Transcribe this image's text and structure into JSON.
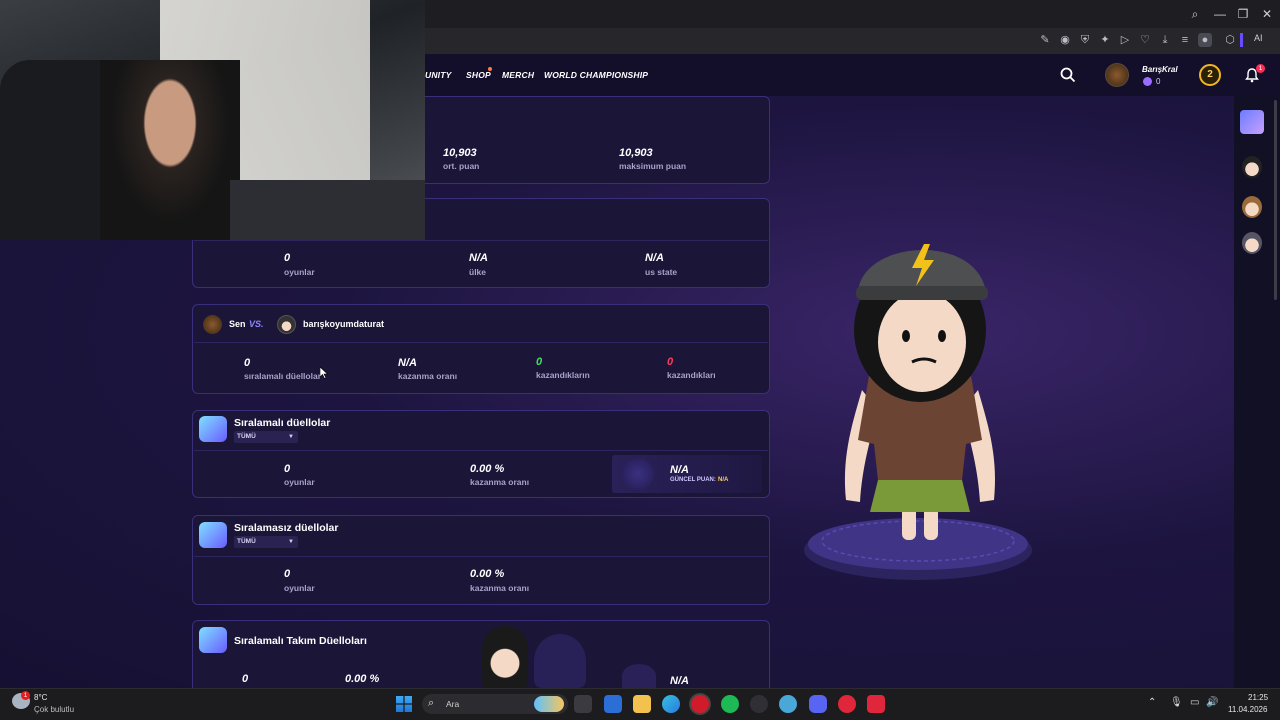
{
  "browser": {
    "ai_label": "AI"
  },
  "nav": {
    "items": [
      "UNITY",
      "SHOP",
      "MERCH",
      "WORLD CHAMPIONSHIP"
    ],
    "username": "BarışKral",
    "coins": "0",
    "level": "2",
    "notif_count": "1"
  },
  "scores": {
    "avg_value": "10,903",
    "avg_label": "ort. puan",
    "max_value": "10,903",
    "max_label": "maksimum puan"
  },
  "stats": {
    "games_value": "0",
    "games_label": "oyunlar",
    "country_value": "N/A",
    "country_label": "ülke",
    "state_value": "N/A",
    "state_label": "us state"
  },
  "versus": {
    "you": "Sen",
    "vs": "VS.",
    "opponent": "barışkoyumdaturat",
    "ranked_duels_value": "0",
    "ranked_duels_label": "sıralamalı düellolar",
    "winrate_value": "N/A",
    "winrate_label": "kazanma oranı",
    "your_wins_value": "0",
    "your_wins_label": "kazandıkların",
    "their_wins_value": "0",
    "their_wins_label": "kazandıkları"
  },
  "ranked": {
    "title": "Sıralamalı düellolar",
    "filter": "TÜMÜ",
    "games_value": "0",
    "games_label": "oyunlar",
    "winrate_value": "0.00 %",
    "winrate_label": "kazanma oranı",
    "rating_value": "N/A",
    "rating_label": "GÜNCEL PUAN:",
    "rating_current": "N/A"
  },
  "unranked": {
    "title": "Sıralamasız düellolar",
    "filter": "TÜMÜ",
    "games_value": "0",
    "games_label": "oyunlar",
    "winrate_value": "0.00 %",
    "winrate_label": "kazanma oranı"
  },
  "team": {
    "title": "Sıralamalı Takım Düelloları",
    "games_value": "0",
    "winrate_value": "0.00 %",
    "rating_value": "N/A"
  },
  "taskbar": {
    "temp": "8°C",
    "weather": "Çok bulutlu",
    "search": "Ara",
    "time": "21:25",
    "date": "11.04.2026",
    "weather_badge": "1"
  }
}
